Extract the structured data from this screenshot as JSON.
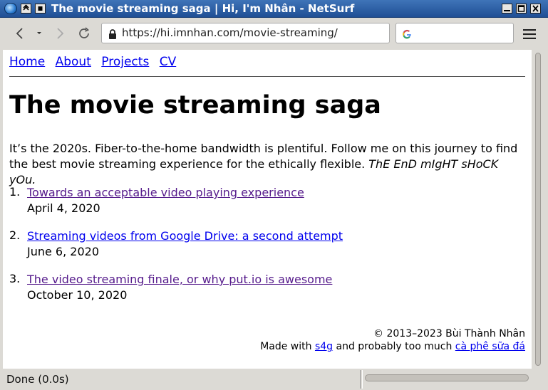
{
  "window": {
    "title": "The movie streaming saga | Hi, I'm Nhân - NetSurf"
  },
  "toolbar": {
    "url": "https://hi.imnhan.com/movie-streaming/",
    "search_placeholder": ""
  },
  "nav": {
    "links": [
      "Home",
      "About",
      "Projects",
      "CV"
    ]
  },
  "page": {
    "title": "The movie streaming saga",
    "intro": "It’s the 2020s. Fiber-to-the-home bandwidth is plentiful. Follow me on this journey to find the best movie streaming experience for the ethically flexible.",
    "intro_em": "ThE EnD mIgHT sHoCK yOu.",
    "posts": [
      {
        "num": "1.",
        "title": "Towards an acceptable video playing experience",
        "date": "April 4, 2020",
        "visited": true
      },
      {
        "num": "2.",
        "title": "Streaming videos from Google Drive: a second attempt",
        "date": "June 6, 2020",
        "visited": false
      },
      {
        "num": "3.",
        "title": "The video streaming finale, or why put.io is awesome",
        "date": "October 10, 2020",
        "visited": true
      }
    ]
  },
  "footer": {
    "copyright": "© 2013–2023 Bùi Thành Nhân",
    "made_prefix": "Made with",
    "made_link1": "s4g",
    "made_middle": "and probably too much",
    "made_link2": "cà phê sữa đá"
  },
  "status": {
    "text": "Done (0.0s)"
  },
  "colors": {
    "link": "#0000ee",
    "visited": "#551a8b",
    "titlebar": "#2a5ea7"
  }
}
